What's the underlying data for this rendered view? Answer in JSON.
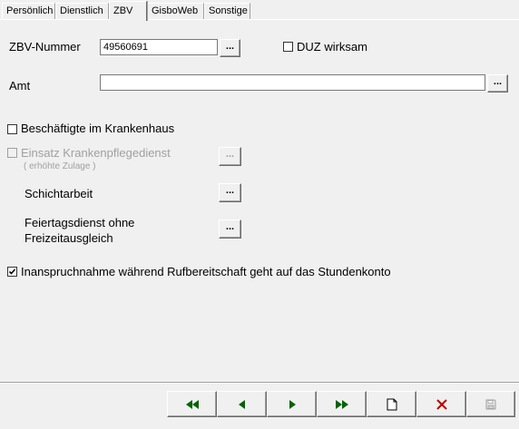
{
  "tabs": [
    "Persönlich",
    "Dienstlich",
    "ZBV",
    "GisboWeb",
    "Sonstige"
  ],
  "active_tab": "ZBV",
  "zbv": {
    "nummer_label": "ZBV-Nummer",
    "nummer_value": "49560691",
    "duz_label": "DUZ wirksam",
    "duz_checked": false,
    "amt_label": "Amt",
    "amt_value": ""
  },
  "options": {
    "krankenhaus_label": "Beschäftigte im Krankenhaus",
    "krankenhaus_checked": false,
    "krankenpflege_label": "Einsatz Krankenpflegedienst",
    "krankenpflege_sublabel": "( erhöhte Zulage )",
    "krankenpflege_enabled": false,
    "schicht_label": "Schichtarbeit",
    "feiertag_label_line1": "Feiertagsdienst ohne",
    "feiertag_label_line2": "Freizeitausgleich",
    "rufbereitschaft_label": "Inanspruchnahme während Rufbereitschaft geht auf das Stundenkonto",
    "rufbereitschaft_checked": true
  },
  "browse_button_label": "...",
  "navigation": {
    "buttons": [
      "first-icon",
      "previous-icon",
      "next-icon",
      "last-icon",
      "new-document-icon",
      "delete-icon",
      "save-icon"
    ]
  },
  "colors": {
    "nav_arrow": "#006400",
    "delete": "#c00000",
    "disabled": "#a0a0a0"
  }
}
